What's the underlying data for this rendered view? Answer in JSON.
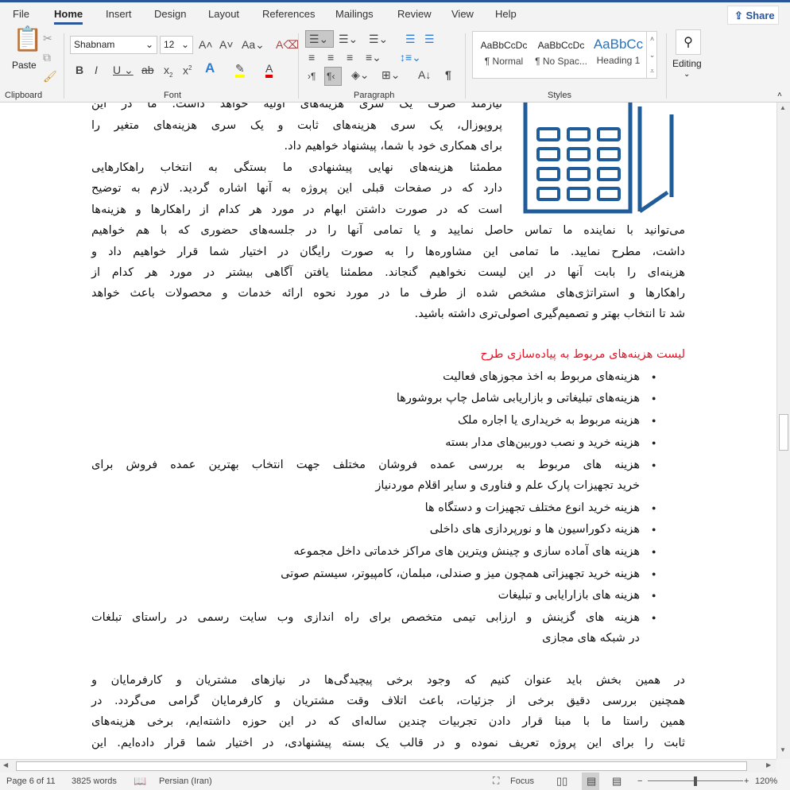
{
  "ribbon": {
    "tabs": [
      "File",
      "Home",
      "Insert",
      "Design",
      "Layout",
      "References",
      "Mailings",
      "Review",
      "View",
      "Help"
    ],
    "active_tab": "Home",
    "share": "Share",
    "paste": "Paste",
    "font_name": "Shabnam",
    "font_size": "12",
    "groups": {
      "clipboard": "Clipboard",
      "font": "Font",
      "paragraph": "Paragraph",
      "styles": "Styles"
    },
    "styles": [
      {
        "preview": "AaBbCcDc",
        "label": "¶ Normal"
      },
      {
        "preview": "AaBbCcDc",
        "label": "¶ No Spac..."
      },
      {
        "preview": "AaBbCc",
        "label": "Heading 1"
      }
    ],
    "editing": "Editing",
    "colors": {
      "accent": "#2b579a",
      "highlight": "#ffff00",
      "font_color": "#e00000"
    }
  },
  "document": {
    "intro_lines": [
      "نیازمند صرف یک سری هزینه‌های اولیه خواهد داشت. ما در این",
      "پروپوزال، یک سری هزینه‌های ثابت و یک سری هزینه‌های متغیر را",
      "برای همکاری خود با شما، پیشنهاد خواهیم داد.",
      "مطمئنا هزینه‌های نهایی پیشنهادی ما بستگی به انتخاب راهکارهایی",
      "دارد که در صفحات قبلی این پروژه به آنها اشاره گردید. لازم به توضیح",
      "است که در صورت داشتن ابهام در مورد هر کدام از راهکارها و هزینه‌ها",
      "می‌توانید با نماینده ما تماس حاصل نمایید و یا تمامی آنها را در جلسه‌های حضوری که با هم خواهیم",
      "داشت، مطرح نمایید. ما تمامی این مشاوره‌ها را به صورت رایگان در اختیار شما قرار خواهیم داد و",
      "هزینه‌ای را بابت آنها در این لیست نخواهیم گنجاند. مطمئنا یافتن آگاهی بیشتر در مورد هر کدام از",
      "راهکارها و استراتژی‌های مشخص شده از طرف ما در مورد نحوه ارائه خدمات و محصولات باعث خواهد",
      "شد تا انتخاب بهتر و تصمیم‌گیری اصولی‌تری داشته باشید."
    ],
    "heading": "لیست هزینه‌های مربوط به پیاده‌سازی طرح",
    "heading_color": "#e81123",
    "bullets": [
      [
        "هزینه‌های مربوط به اخذ مجوزهای فعالیت"
      ],
      [
        "هزینه‌های تبلیغاتی و بازاریابی شامل چاپ بروشورها"
      ],
      [
        "هزینه مربوط به خریداری یا اجاره ملک"
      ],
      [
        "هزینه خرید و نصب دوربین‌های مدار بسته"
      ],
      [
        "هزینه های مربوط به بررسی عمده فروشان مختلف جهت انتخاب بهترین عمده فروش برای",
        "خرید تجهیزات پارک علم و فناوری و سایر اقلام موردنیاز"
      ],
      [
        "هزینه خرید انوع مختلف تجهیزات و دستگاه ها"
      ],
      [
        "هزینه دکوراسیون ها و نورپردازی های داخلی"
      ],
      [
        "هزینه های آماده سازی و چینش ویترین های مراکز خدماتی داخل مجموعه"
      ],
      [
        "هزینه خرید تجهیزاتی همچون میز و صندلی، مبلمان، کامپیوتر، سیستم صوتی"
      ],
      [
        "هزینه های بازارایابی و تبلیغات"
      ],
      [
        "هزینه های گزینش و ارزابی تیمی متخصص برای راه اندازی وب سایت رسمی در راستای تبلغات",
        "در شبکه های مجازی"
      ]
    ],
    "closing_lines": [
      "در همین بخش باید عنوان کنیم که وجود برخی پیچیدگی‌ها در نیازهای مشتریان و کارفرمایان و",
      "همچنین بررسی دقیق برخی از جزئیات، باعث اتلاف وقت مشتریان و کارفرمایان گرامی می‌گردد. در",
      "همین راستا ما با مبنا قرار دادن تجربیات چندین ساله‌ای که در این حوزه داشته‌ایم، برخی هزینه‌های",
      "ثابت را برای این پروژه تعریف نموده و در قالب یک بسته پیشنهادی، در اختیار شما قرار داده‌ایم. این"
    ],
    "image_color": "#1f5c99"
  },
  "status": {
    "page": "Page 6 of 11",
    "words": "3825 words",
    "language": "Persian (Iran)",
    "focus": "Focus",
    "zoom": "120%",
    "zoom_level": 120
  }
}
